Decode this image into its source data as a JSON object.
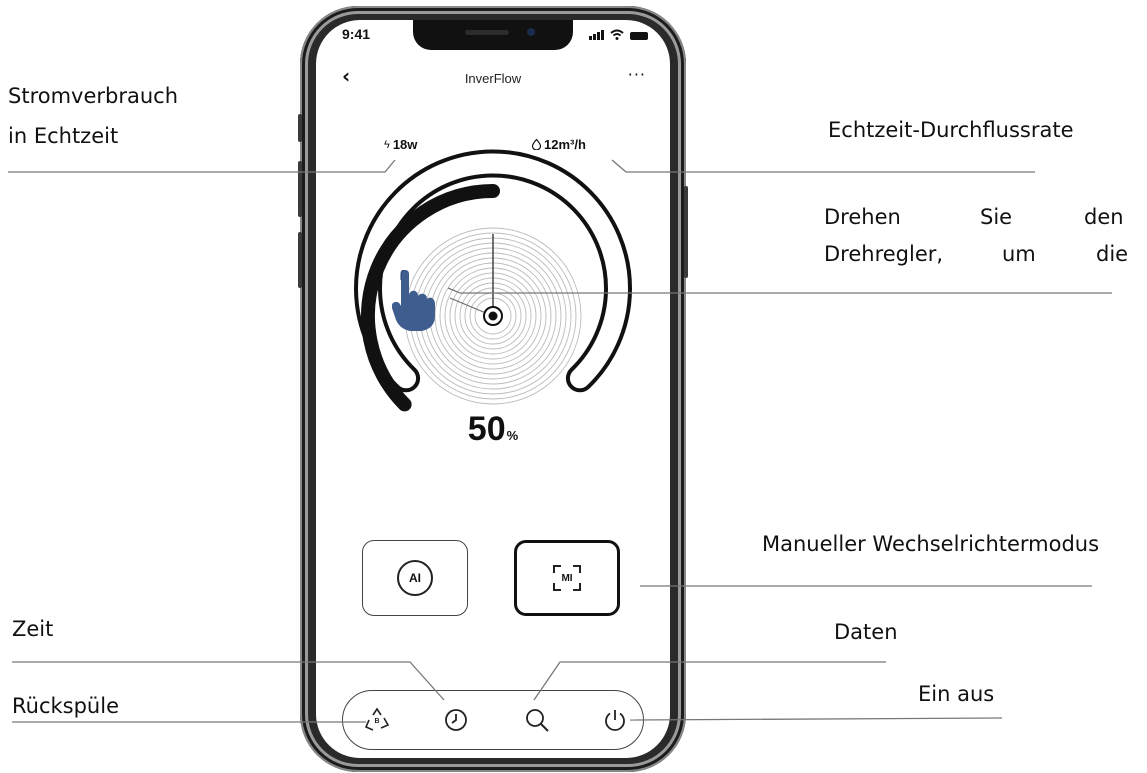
{
  "status_bar": {
    "time": "9:41"
  },
  "nav": {
    "back_icon": "chevron-left-icon",
    "title": "InverFlow",
    "more_icon": "more-horizontal-icon"
  },
  "metrics": {
    "power": {
      "icon": "lightning-icon",
      "value": "18w"
    },
    "flow": {
      "icon": "water-drop-icon",
      "value": "12m³/h"
    }
  },
  "dial": {
    "level": 0.5,
    "percent_value": "50",
    "percent_unit": "%",
    "hand_icon": "pointing-hand-icon"
  },
  "mode_buttons": {
    "ai": {
      "icon": "ai-auto-mode-icon",
      "label": "AI"
    },
    "mi": {
      "icon": "mi-manual-mode-icon",
      "label": "MI"
    }
  },
  "bottom_bar": {
    "items": [
      {
        "icon": "backwash-recycle-icon",
        "badge": "B"
      },
      {
        "icon": "clock-icon"
      },
      {
        "icon": "search-icon"
      },
      {
        "icon": "power-icon"
      }
    ]
  },
  "callouts": {
    "power_consumption_line1": "Stromverbrauch",
    "power_consumption_line2": "in Echtzeit",
    "flow_rate": "Echtzeit-Durchflussrate",
    "dial_line1_word1": "Drehen",
    "dial_line1_word2": "Sie",
    "dial_line1_word3": "den",
    "dial_line2_word1": "Drehregler,",
    "dial_line2_word2": "um",
    "dial_line2_word3": "die",
    "manual_mode": "Manueller Wechselrichtermodus",
    "time": "Zeit",
    "data": "Daten",
    "backwash": "Rückspüle",
    "on_off": "Ein aus"
  },
  "colors": {
    "accent_hand": "#3f5d8f",
    "phone_frame": "#2a2a2a",
    "dial_ring": "#111111"
  }
}
